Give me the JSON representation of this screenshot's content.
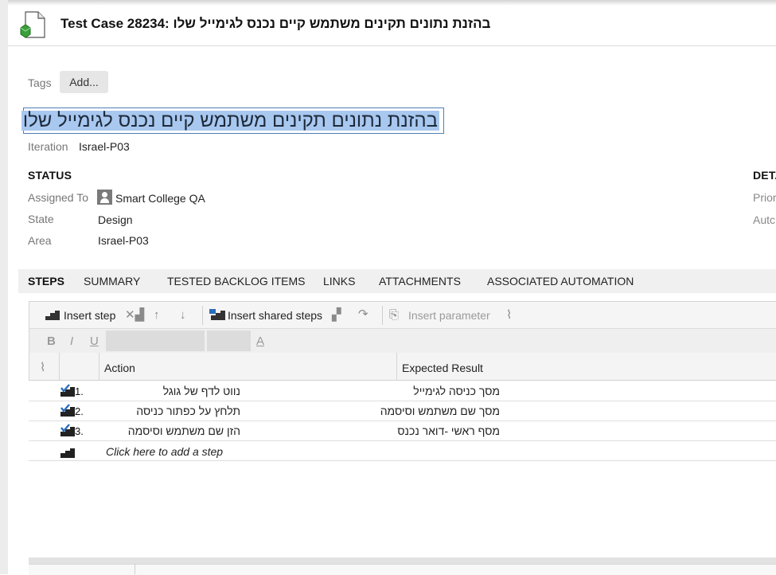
{
  "header": {
    "prefix": "Test Case 28234:",
    "name": "בהזנת נתונים תקינים משתמש קיים נכנס לגימייל שלו"
  },
  "tags": {
    "label": "Tags",
    "add_label": "Add..."
  },
  "title": {
    "value": "בהזנת נתונים תקינים משתמש קיים נכנס לגימייל שלו"
  },
  "iteration": {
    "label": "Iteration",
    "value": "Israel-P03"
  },
  "status": {
    "heading": "STATUS",
    "assigned_to_label": "Assigned To",
    "assigned_to_value": "Smart College QA",
    "state_label": "State",
    "state_value": "Design",
    "area_label": "Area",
    "area_value": "Israel-P03"
  },
  "details": {
    "heading": "DETA",
    "priority_label": "Prior",
    "automation_label": "Autc"
  },
  "tabs": [
    {
      "label": "STEPS",
      "active": true
    },
    {
      "label": "SUMMARY"
    },
    {
      "label": "TESTED BACKLOG ITEMS"
    },
    {
      "label": "LINKS"
    },
    {
      "label": "ATTACHMENTS"
    },
    {
      "label": "ASSOCIATED AUTOMATION"
    }
  ],
  "toolbar": {
    "insert_step": "Insert step",
    "insert_shared_steps": "Insert shared steps",
    "insert_parameter": "Insert parameter",
    "bold": "B",
    "italic": "I",
    "underline": "U",
    "font_color": "A"
  },
  "grid": {
    "columns": {
      "action": "Action",
      "expected": "Expected Result"
    },
    "steps": [
      {
        "num": "1.",
        "action": "נווט לדף של גוגל",
        "expected": "מסך כניסה לגימייל"
      },
      {
        "num": "2.",
        "action": "תלחץ על כפתור כניסה",
        "expected": "מסך שם משתמש וסיסמה"
      },
      {
        "num": "3.",
        "action": "הזן שם משתמש וסיסמה",
        "expected": "מסף ראשי -דואר נכנס"
      }
    ],
    "add_step_text": "Click here to add a step"
  },
  "colors": {
    "accent": "#4f7fb6",
    "selection": "#a9c8f0",
    "step_check": "#2a6ebb"
  }
}
